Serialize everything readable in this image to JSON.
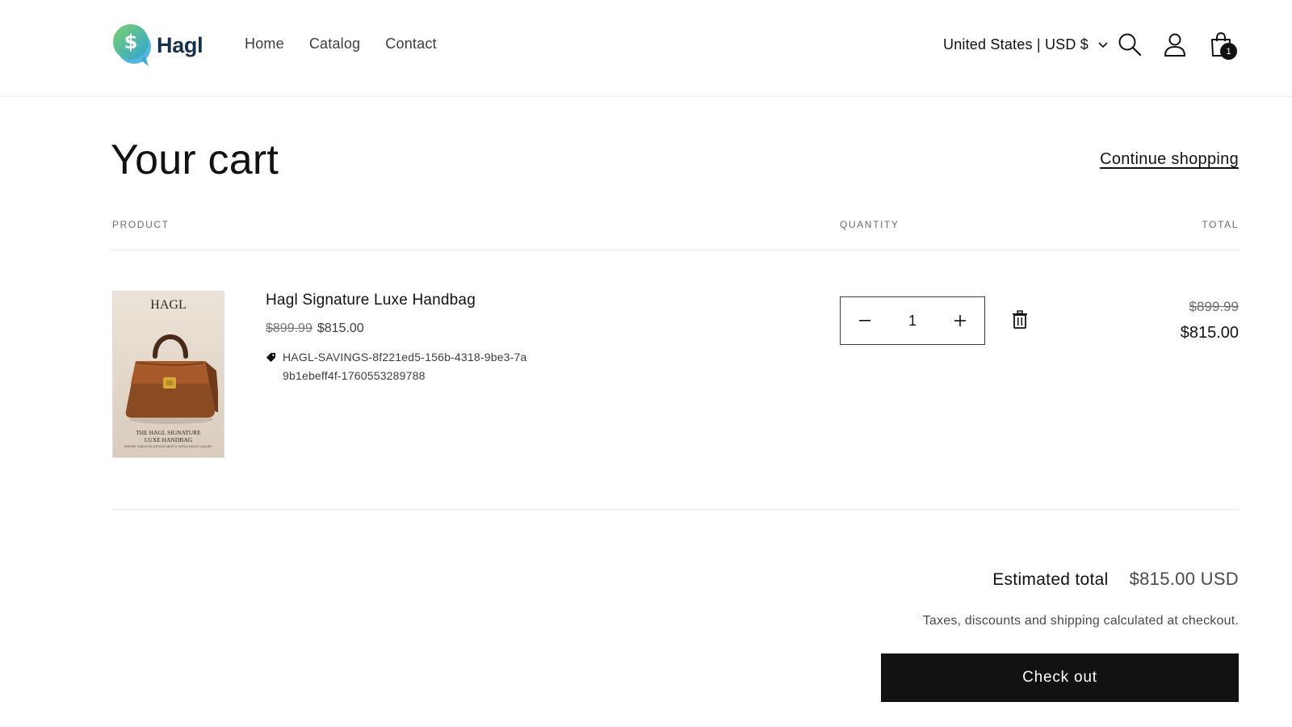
{
  "brand": {
    "name": "Hagl",
    "logo_icon": "dollar-chat-bubble-icon"
  },
  "nav": [
    {
      "label": "Home"
    },
    {
      "label": "Catalog"
    },
    {
      "label": "Contact"
    }
  ],
  "header": {
    "country_selector": "United States | USD $",
    "icons": [
      "search-icon",
      "account-icon",
      "cart-icon"
    ],
    "cart_count": "1"
  },
  "cart": {
    "title": "Your cart",
    "continue_label": "Continue shopping",
    "columns": {
      "product": "PRODUCT",
      "quantity": "QUANTITY",
      "total": "TOTAL"
    },
    "items": [
      {
        "name": "Hagl Signature Luxe Handbag",
        "original_price": "$899.99",
        "price": "$815.00",
        "discount_code": "HAGL-SAVINGS-8f221ed5-156b-4318-9be3-7a9b1ebeff4f-1760553289788",
        "quantity": "1",
        "line_original": "$899.99",
        "line_total": "$815.00",
        "image": {
          "brand": "HAGL",
          "caption_line1": "THE HAGL SIGNATURE",
          "caption_line2": "LUXE HANDBAG",
          "subcaption": "WHERE TIMELESS DESIGN MEETS INTELLIGENT LUXURY"
        }
      }
    ]
  },
  "summary": {
    "estimated_label": "Estimated total",
    "estimated_value": "$815.00 USD",
    "note": "Taxes, discounts and shipping calculated at checkout.",
    "checkout_label": "Check out"
  },
  "colors": {
    "accent": "#121212",
    "logo_green": "#5cc36a",
    "logo_blue": "#3aa9d8",
    "logo_text": "#17304f"
  }
}
